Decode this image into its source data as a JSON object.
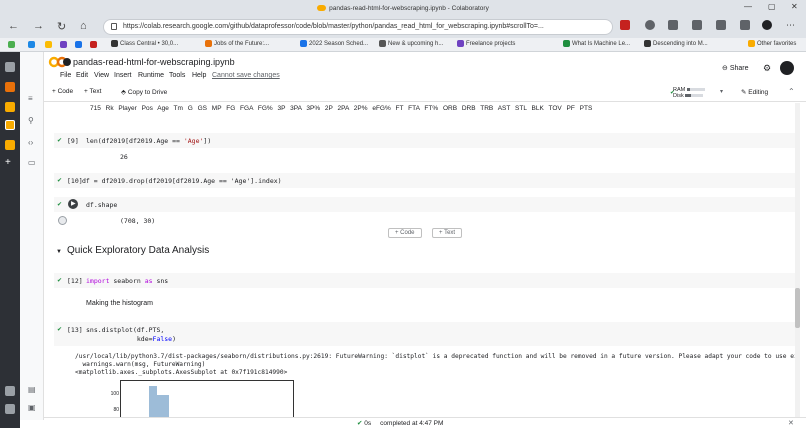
{
  "browser": {
    "tab_title": "pandas-read-html-for-webscraping.ipynb - Colaboratory",
    "url": "https://colab.research.google.com/github/dataprofessor/code/blob/master/python/pandas_read_html_for_webscraping.ipynb#scrollTo=..."
  },
  "bookmarks": [
    {
      "label": "Class Central • 30,0...",
      "color": "#333333"
    },
    {
      "label": "Jobs of the Future:...",
      "color": "#e8710a"
    },
    {
      "label": "2022 Season Sched...",
      "color": "#1a73e8"
    },
    {
      "label": "New & upcoming h...",
      "color": "#555555"
    },
    {
      "label": "Freelance projects",
      "color": "#6f42c1"
    },
    {
      "label": "What Is Machine Le...",
      "color": "#1e8e3e"
    },
    {
      "label": "Descending into M...",
      "color": "#333333"
    },
    {
      "label": "Other favorites",
      "color": "#f9ab00"
    }
  ],
  "colab": {
    "notebook_name": "pandas-read-html-for-webscraping.ipynb",
    "menu": [
      "File",
      "Edit",
      "View",
      "Insert",
      "Runtime",
      "Tools",
      "Help"
    ],
    "unsaved": "Cannot save changes",
    "share": "Share",
    "toolbar": {
      "code": "+ Code",
      "text": "+ Text",
      "copy": "Copy to Drive",
      "ram": "RAM",
      "disk": "Disk",
      "ram_fraction": 0.2,
      "disk_fraction": 0.3,
      "editing": "Editing"
    }
  },
  "cells": {
    "table_header": "715   Rk   Player   Pos   Age   Tm   G   GS   MP   FG   FGA   FG%   3P   3PA   3P%   2P   2PA   2P%   eFG%   FT   FTA   FT%   ORB   DRB   TRB   AST   STL   BLK   TOV   PF   PTS",
    "c9_num": "[9]",
    "c9_code_a": "len(df2019[df2019.Age == ",
    "c9_str": "'Age'",
    "c9_code_b": "])",
    "c9_out": "26",
    "c10_num": "[10]",
    "c10_code": "df = df2019.drop(df2019[df2019.Age == 'Age'].index)",
    "c11_code": "df.shape",
    "c11_out": "(708, 30)",
    "add_code": "+ Code",
    "add_text": "+ Text",
    "section_title": "Quick Exploratory Data Analysis",
    "c12_num": "[12]",
    "c12_kw1": "import",
    "c12_mod": " seaborn ",
    "c12_kw2": "as",
    "c12_alias": " sns",
    "md_text": "Making the histogram",
    "c13_num": "[13]",
    "c13_line1": "sns.distplot(df.PTS,",
    "c13_line2a": "             kde=",
    "c13_line2b": "False",
    "c13_line2c": ")",
    "c13_out": "/usr/local/lib/python3.7/dist-packages/seaborn/distributions.py:2619: FutureWarning: `distplot` is a deprecated function and will be removed in a future version. Please adapt your code to use either\n  warnings.warn(msg, FutureWarning)\n<matplotlib.axes._subplots.AxesSubplot at 0x7f191c814990>",
    "hist_ticks": [
      "100",
      "80"
    ]
  },
  "status": {
    "elapsed": "0s",
    "message": "completed at 4:47 PM"
  }
}
